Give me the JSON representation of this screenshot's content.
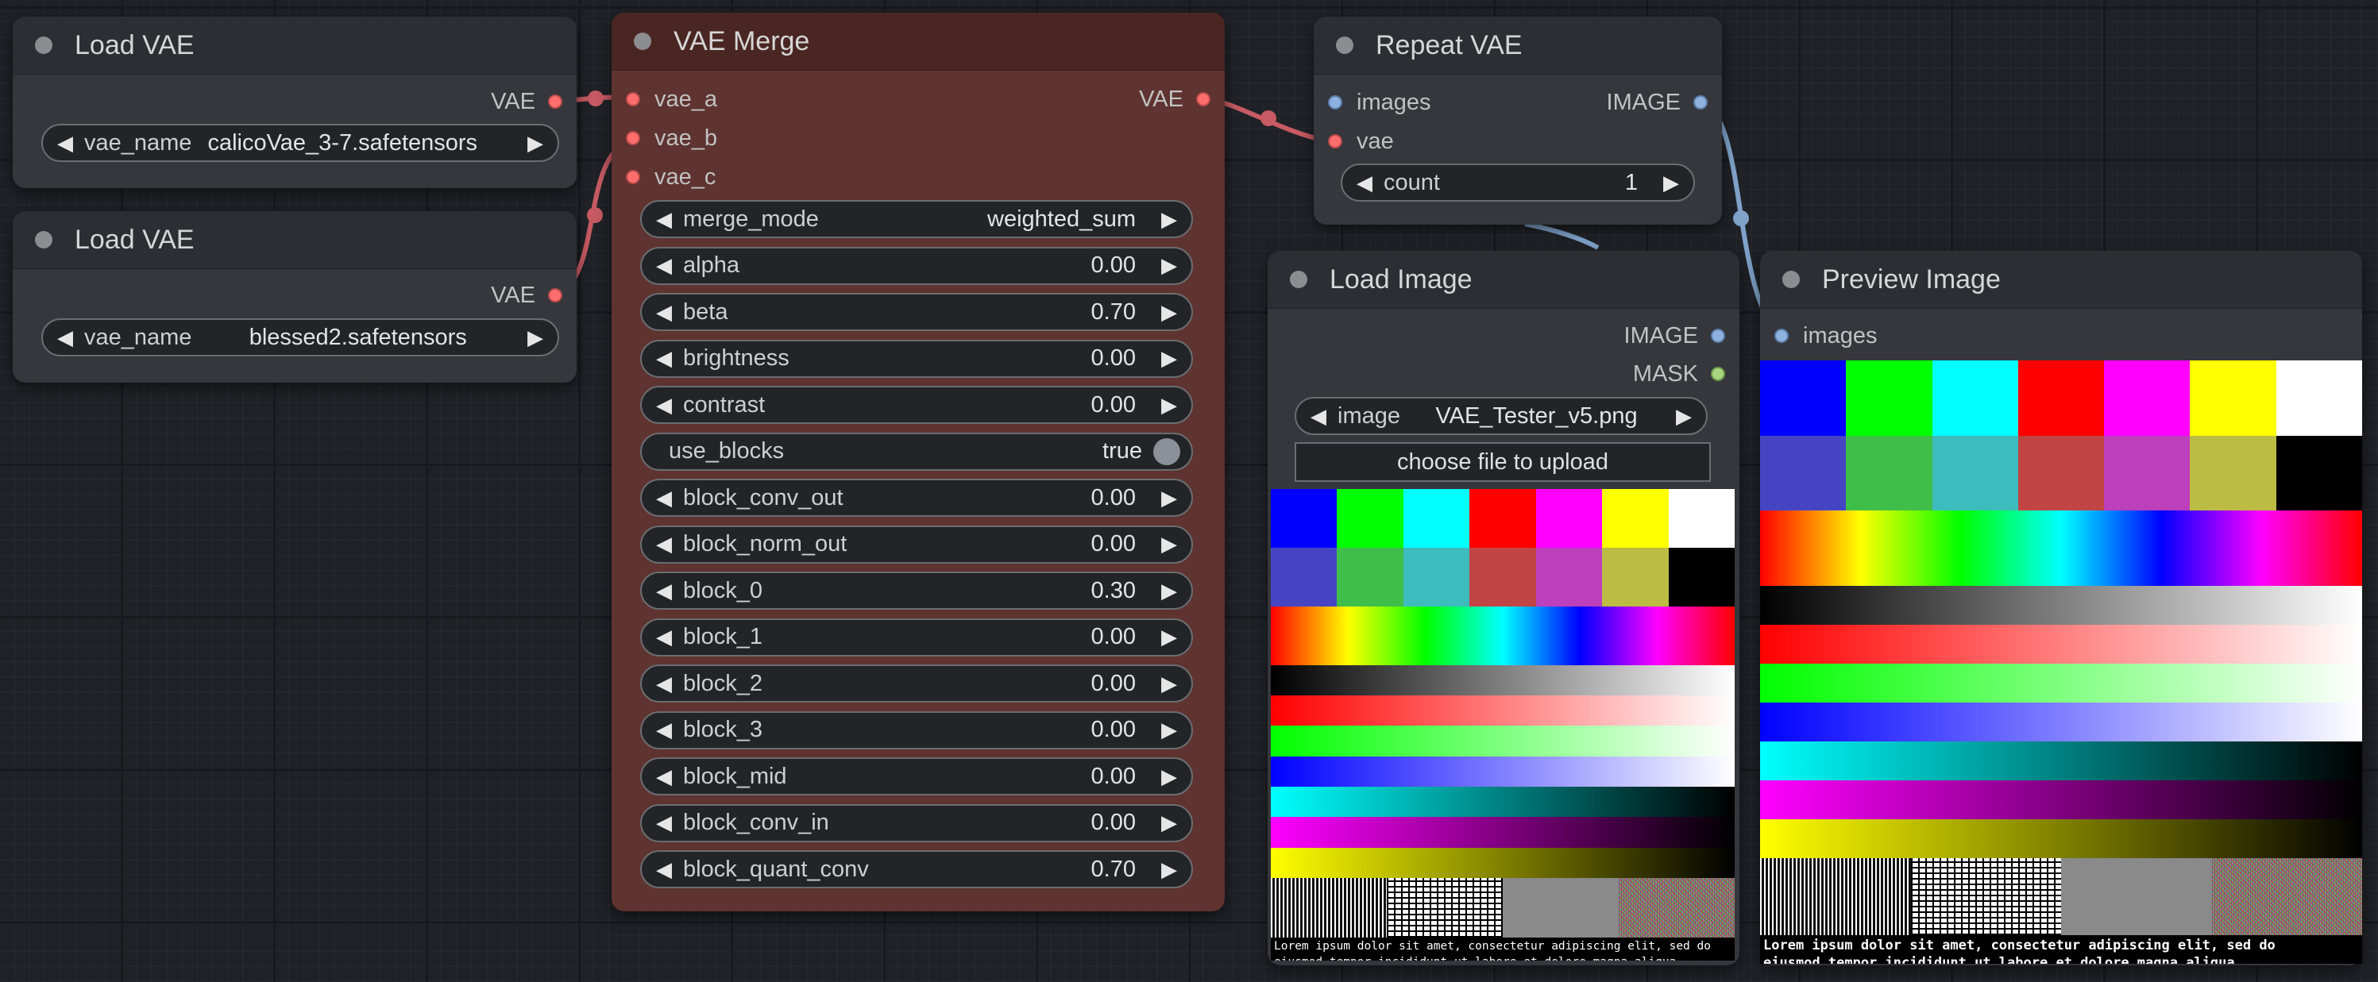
{
  "colors": {
    "vae_wire": "#c75a63",
    "image_wire": "#7fa2c9",
    "merge_node_bg": "#5e3330",
    "merge_node_header": "#4a2622"
  },
  "nodes": {
    "load_vae_1": {
      "title": "Load VAE",
      "output_label": "VAE",
      "widget_label": "vae_name",
      "widget_value": "calicoVae_3-7.safetensors"
    },
    "load_vae_2": {
      "title": "Load VAE",
      "output_label": "VAE",
      "widget_label": "vae_name",
      "widget_value": "blessed2.safetensors"
    },
    "vae_merge": {
      "title": "VAE Merge",
      "inputs": [
        "vae_a",
        "vae_b",
        "vae_c"
      ],
      "output_label": "VAE",
      "widgets": [
        {
          "label": "merge_mode",
          "value": "weighted_sum"
        },
        {
          "label": "alpha",
          "value": "0.00"
        },
        {
          "label": "beta",
          "value": "0.70"
        },
        {
          "label": "brightness",
          "value": "0.00"
        },
        {
          "label": "contrast",
          "value": "0.00"
        },
        {
          "label": "use_blocks",
          "value": "true",
          "type": "toggle"
        },
        {
          "label": "block_conv_out",
          "value": "0.00"
        },
        {
          "label": "block_norm_out",
          "value": "0.00"
        },
        {
          "label": "block_0",
          "value": "0.30"
        },
        {
          "label": "block_1",
          "value": "0.00"
        },
        {
          "label": "block_2",
          "value": "0.00"
        },
        {
          "label": "block_3",
          "value": "0.00"
        },
        {
          "label": "block_mid",
          "value": "0.00"
        },
        {
          "label": "block_conv_in",
          "value": "0.00"
        },
        {
          "label": "block_quant_conv",
          "value": "0.70"
        }
      ]
    },
    "repeat_vae": {
      "title": "Repeat VAE",
      "inputs": [
        "images",
        "vae"
      ],
      "output_label": "IMAGE",
      "widget_label": "count",
      "widget_value": "1"
    },
    "load_image": {
      "title": "Load Image",
      "outputs": [
        "IMAGE",
        "MASK"
      ],
      "widget_label": "image",
      "widget_value": "VAE_Tester_v5.png",
      "upload_label": "choose file to upload",
      "lorem_line1": "Lorem ipsum dolor sit amet, consectetur adipiscing elit, sed do",
      "lorem_line2": "eiusmod tempor incididunt ut labore et dolore magna aliqua."
    },
    "preview_image": {
      "title": "Preview Image",
      "inputs": [
        "images"
      ],
      "lorem_line1": "Lorem ipsum dolor sit amet, consectetur adipiscing elit, sed do",
      "lorem_line2": "eiusmod tempor incididunt ut labore et dolore magna aliqua."
    }
  }
}
